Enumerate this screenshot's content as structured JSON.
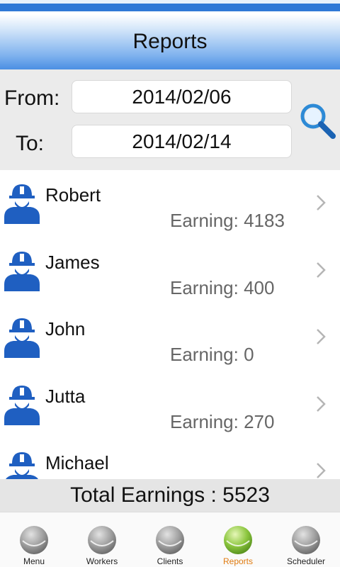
{
  "header": {
    "title": "Reports"
  },
  "filter": {
    "from_label": "From:",
    "from_value": "2014/02/06",
    "to_label": "To:",
    "to_value": "2014/02/14"
  },
  "workers": [
    {
      "name": "Robert",
      "earning": "Earning: 4183"
    },
    {
      "name": "James",
      "earning": "Earning: 400"
    },
    {
      "name": "John",
      "earning": "Earning: 0"
    },
    {
      "name": "Jutta",
      "earning": "Earning: 270"
    },
    {
      "name": "Michael",
      "earning": ""
    }
  ],
  "total": {
    "text": "Total Earnings : 5523"
  },
  "tabs": [
    {
      "label": "Menu",
      "active": false
    },
    {
      "label": "Workers",
      "active": false
    },
    {
      "label": "Clients",
      "active": false
    },
    {
      "label": "Reports",
      "active": true
    },
    {
      "label": "Scheduler",
      "active": false
    }
  ],
  "colors": {
    "accent": "#2f78d6",
    "active_tab": "#e07b10",
    "active_ball": "#8cc63f"
  }
}
